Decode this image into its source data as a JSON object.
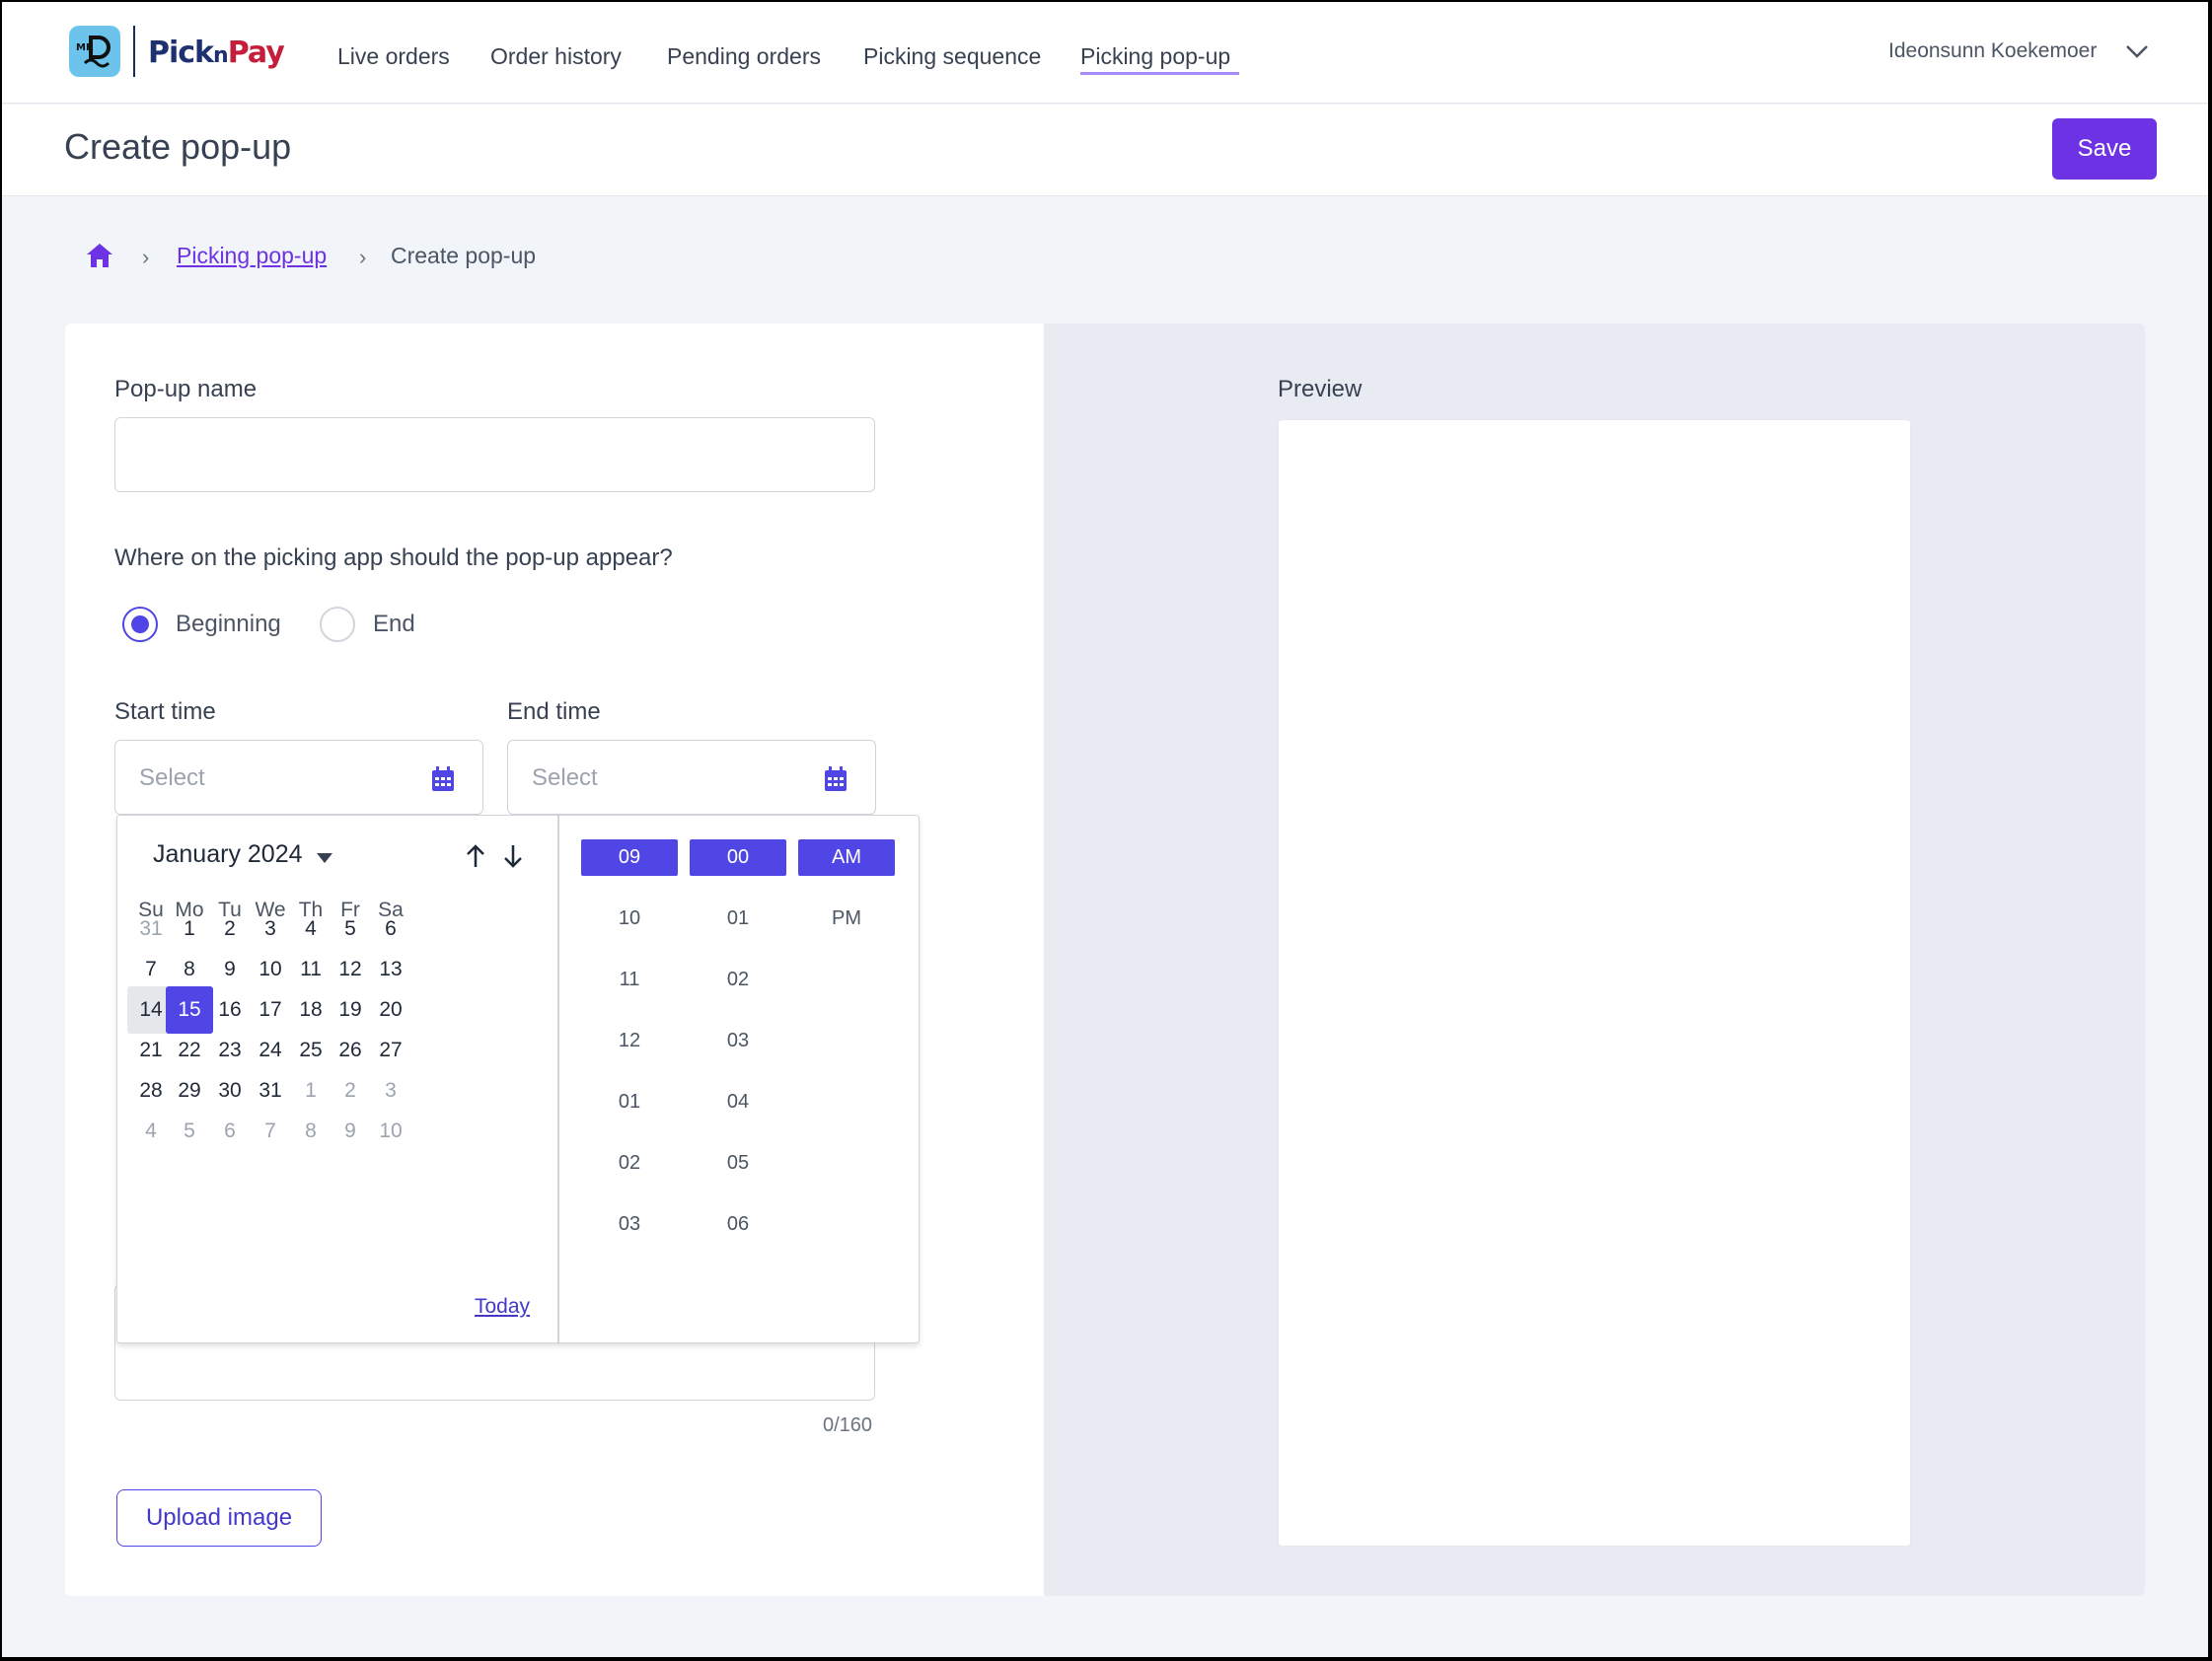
{
  "nav": {
    "logo_text_left": "Pick",
    "logo_text_n": "n",
    "logo_text_right": "Pay",
    "badge_text": "MR",
    "links": [
      "Live orders",
      "Order history",
      "Pending orders",
      "Picking sequence",
      "Picking pop-up"
    ],
    "active_link": "Picking pop-up",
    "user_name": "Ideonsunn Koekemoer"
  },
  "header": {
    "title": "Create pop-up",
    "save_label": "Save"
  },
  "breadcrumb": {
    "sep": "›",
    "link": "Picking pop-up",
    "current": "Create pop-up"
  },
  "form": {
    "name_label": "Pop-up name",
    "name_value": "",
    "placement_question": "Where on the picking app should the pop-up appear?",
    "placement_options": [
      "Beginning",
      "End"
    ],
    "placement_selected": "Beginning",
    "start_label": "Start time",
    "end_label": "End time",
    "start_placeholder": "Select",
    "end_placeholder": "Select",
    "message_counter": "0/160",
    "upload_label": "Upload image"
  },
  "preview": {
    "label": "Preview"
  },
  "datepicker": {
    "month_label": "January 2024",
    "weekdays": [
      "Su",
      "Mo",
      "Tu",
      "We",
      "Th",
      "Fr",
      "Sa"
    ],
    "weeks": [
      [
        "31",
        "1",
        "2",
        "3",
        "4",
        "5",
        "6"
      ],
      [
        "7",
        "8",
        "9",
        "10",
        "11",
        "12",
        "13"
      ],
      [
        "14",
        "15",
        "16",
        "17",
        "18",
        "19",
        "20"
      ],
      [
        "21",
        "22",
        "23",
        "24",
        "25",
        "26",
        "27"
      ],
      [
        "28",
        "29",
        "30",
        "31",
        "1",
        "2",
        "3"
      ],
      [
        "4",
        "5",
        "6",
        "7",
        "8",
        "9",
        "10"
      ]
    ],
    "today_day": "14",
    "selected_day": "15",
    "today_label": "Today",
    "hours": [
      "09",
      "10",
      "11",
      "12",
      "01",
      "02",
      "03"
    ],
    "minutes": [
      "00",
      "01",
      "02",
      "03",
      "04",
      "05",
      "06"
    ],
    "meridiem": [
      "AM",
      "PM"
    ],
    "selected_hour": "09",
    "selected_minute": "00",
    "selected_meridiem": "AM"
  },
  "colors": {
    "brand_purple": "#6d32e4",
    "accent_indigo": "#4f46e5",
    "logo_badge": "#6cc4ec"
  }
}
